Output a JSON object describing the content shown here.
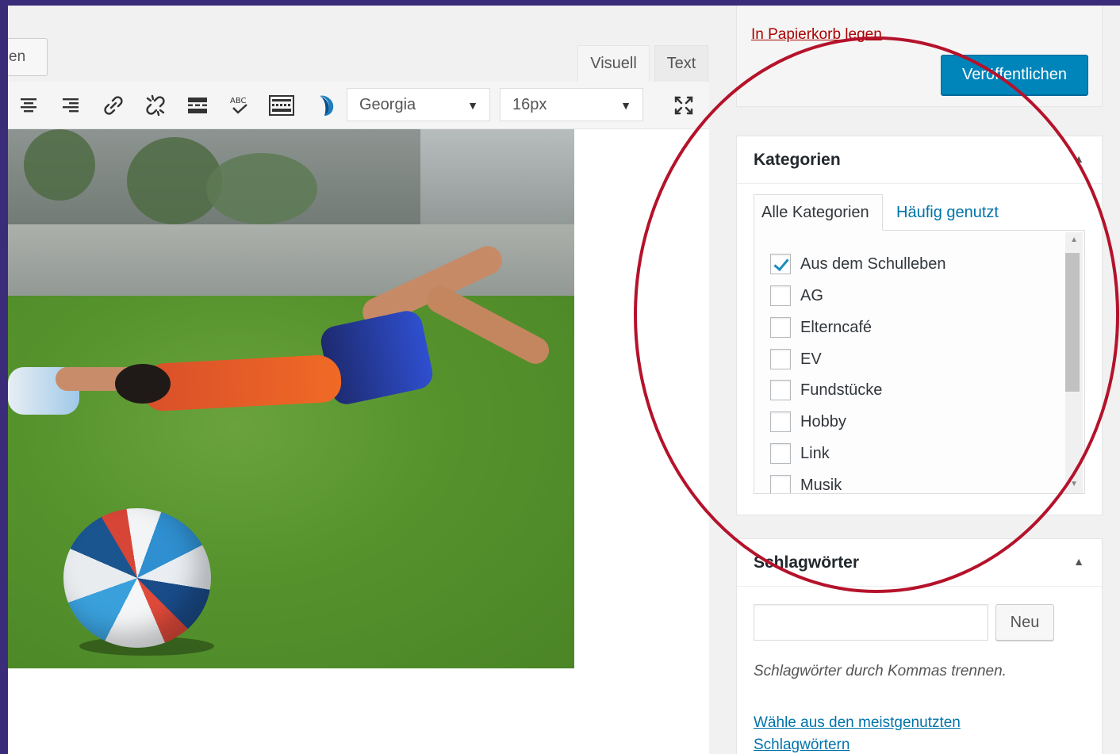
{
  "editor": {
    "media_button_label": "en",
    "tabs": [
      {
        "label": "Visuell",
        "active": true
      },
      {
        "label": "Text",
        "active": false
      }
    ],
    "toolbar": {
      "icons": [
        "align-center-icon",
        "align-right-icon",
        "insert-link-icon",
        "remove-link-icon",
        "read-more-icon",
        "spellcheck-icon",
        "toolbar-toggle-icon",
        "plugin-moon-icon"
      ],
      "font_family": "Georgia",
      "font_size": "16px",
      "fullscreen_icon": "fullscreen-icon"
    }
  },
  "sidebar": {
    "publish": {
      "trash_link": "In Papierkorb legen",
      "publish_button": "Veröffentlichen"
    },
    "categories": {
      "title": "Kategorien",
      "tabs": [
        {
          "label": "Alle Kategorien",
          "active": true
        },
        {
          "label": "Häufig genutzt",
          "active": false
        }
      ],
      "items": [
        {
          "label": "Aus dem Schulleben",
          "checked": true
        },
        {
          "label": "AG",
          "checked": false
        },
        {
          "label": "Elterncafé",
          "checked": false
        },
        {
          "label": "EV",
          "checked": false
        },
        {
          "label": "Fundstücke",
          "checked": false
        },
        {
          "label": "Hobby",
          "checked": false
        },
        {
          "label": "Link",
          "checked": false
        },
        {
          "label": "Musik",
          "checked": false
        }
      ]
    },
    "tags": {
      "title": "Schlagwörter",
      "input_value": "",
      "add_button": "Neu",
      "hint": "Schlagwörter durch Kommas trennen.",
      "choose_link": "Wähle aus den meistgenutzten Schlagwörtern"
    }
  },
  "colors": {
    "accent": "#0085ba",
    "link": "#0073aa",
    "delete": "#a00000",
    "annotation": "#b5122b"
  }
}
